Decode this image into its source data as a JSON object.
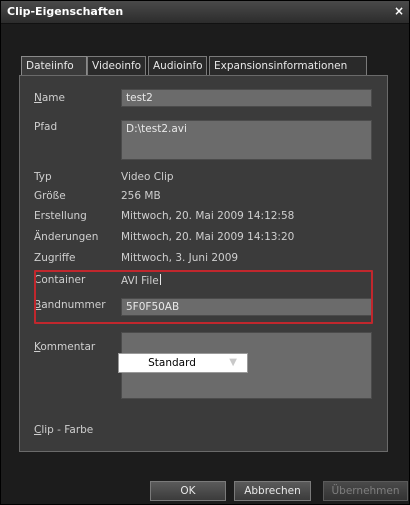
{
  "window": {
    "title": "Clip-Eigenschaften",
    "close_glyph": "×"
  },
  "tabs": [
    {
      "label": "Dateiinfo",
      "active": true
    },
    {
      "label": "Videoinfo",
      "active": false
    },
    {
      "label": "Audioinfo",
      "active": false
    },
    {
      "label": "Expansionsinformationen",
      "active": false
    }
  ],
  "fields": {
    "name_label": "Name",
    "name_value": "test2",
    "pfad_label": "Pfad",
    "pfad_value": "D:\\test2.avi",
    "typ_label": "Typ",
    "typ_value": "Video Clip",
    "groesse_label": "Größe",
    "groesse_value": "256 MB",
    "erstellung_label": "Erstellung",
    "erstellung_value": "Mittwoch, 20. Mai 2009 14:12:58",
    "aenderungen_label": "Änderungen",
    "aenderungen_value": "Mittwoch, 20. Mai 2009 14:13:20",
    "zugriffe_label": "Zugriffe",
    "zugriffe_value": "Mittwoch, 3. Juni 2009",
    "container_label": "Container",
    "container_value": "AVI File",
    "bandnummer_label": "Bandnummer",
    "bandnummer_value": "5F0F50AB",
    "kommentar_label": "Kommentar",
    "kommentar_value": "",
    "clipfarbe_label": "Clip - Farbe",
    "clipfarbe_value": "Standard"
  },
  "buttons": {
    "ok": "OK",
    "abbrechen": "Abbrechen",
    "uebernehmen": "Übernehmen",
    "uebernehmen_enabled": false
  },
  "colors": {
    "window_bg": "#1c1c1c",
    "panel_bg": "#3b3b3b",
    "field_bg": "#6b6b6b",
    "highlight": "#c1272d"
  }
}
